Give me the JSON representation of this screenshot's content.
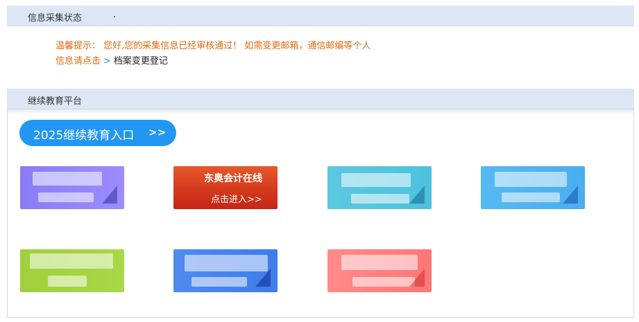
{
  "info_section": {
    "title": "信息采集状态",
    "dot": "."
  },
  "notice": {
    "warning_text": "温馨提示： 您好,您的采集信息已经审核通过！ 如需变更邮箱，通信邮编等个人",
    "link_prefix": "信息请点击",
    "chevron": ">",
    "link_label": "档案变更登记"
  },
  "edu_section": {
    "title": "继续教育平台"
  },
  "entry_button": {
    "label": "2025继续教育入口",
    "arrows": ">>"
  },
  "tiles": [
    {
      "name": "",
      "enter": "",
      "color": "#8a7cf7"
    },
    {
      "name": "东奥会计在线",
      "enter": "点击进入>>",
      "color": "#d33a1e"
    },
    {
      "name": "",
      "enter": "",
      "color": "#4cc2dc"
    },
    {
      "name": "",
      "enter": "",
      "color": "#49aef0"
    },
    {
      "name": "",
      "enter": "",
      "color": "#a8d848"
    },
    {
      "name": "",
      "enter": "",
      "color": "#3f7cea"
    },
    {
      "name": "",
      "enter": "",
      "color": "#ff7676"
    }
  ]
}
